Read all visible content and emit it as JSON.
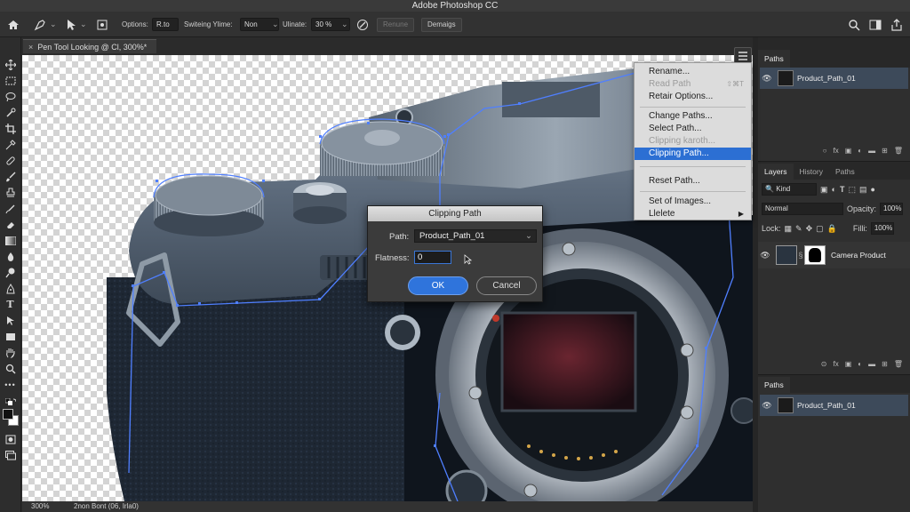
{
  "app": {
    "title": "Adobe Photoshop CC"
  },
  "options_bar": {
    "options_label": "Options:",
    "options_value": "R.to",
    "switching_label": "Switeing Ylime:",
    "switching_value": "Non",
    "ultimate_label": "Ulinate:",
    "ultimate_value": "30 %",
    "rename_button": "Renune",
    "demargs_button": "Demaigs"
  },
  "document": {
    "tab_title": "Pen Tool Looking @ Cl, 300%*",
    "close_symbol": "×"
  },
  "status": {
    "zoom": "300%",
    "info": "2non Bont (06, Irla0)"
  },
  "context_menu": {
    "items": [
      {
        "label": "Rename...",
        "disabled": false,
        "highlighted": false,
        "shortcut": ""
      },
      {
        "label": "Read Path",
        "disabled": true,
        "highlighted": false,
        "shortcut": "⇧⌘T"
      },
      {
        "label": "Retair Options...",
        "disabled": false,
        "highlighted": false,
        "shortcut": ""
      },
      {
        "label": "Change Paths...",
        "disabled": false,
        "highlighted": false,
        "shortcut": ""
      },
      {
        "label": "Select Path...",
        "disabled": false,
        "highlighted": false,
        "shortcut": ""
      },
      {
        "label": "Clipping karoth...",
        "disabled": true,
        "highlighted": false,
        "shortcut": ""
      },
      {
        "label": "Clipping Path...",
        "disabled": false,
        "highlighted": true,
        "shortcut": ""
      },
      {
        "label": "Reset Path...",
        "disabled": false,
        "highlighted": false,
        "shortcut": ""
      },
      {
        "label": "Set of Images...",
        "disabled": false,
        "highlighted": false,
        "shortcut": ""
      },
      {
        "label": "Llelete",
        "disabled": false,
        "highlighted": false,
        "shortcut": "▶"
      }
    ]
  },
  "dialog": {
    "title": "Clipping Path",
    "path_label": "Path:",
    "path_value": "Product_Path_01",
    "flatness_label": "Flatness:",
    "flatness_value": "0",
    "ok_label": "OK",
    "cancel_label": "Cancel"
  },
  "paths_panel_top": {
    "tab": "Paths",
    "path_name": "Product_Path_01"
  },
  "layers_panel": {
    "tabs": [
      "Layers",
      "History",
      "Paths"
    ],
    "kind_label": "Kind",
    "blend_mode": "Normal",
    "opacity_label": "Opacity:",
    "opacity_value": "100%",
    "lock_label": "Lock:",
    "fill_label": "Filli:",
    "fill_value": "100%",
    "layer_name": "Camera Product"
  },
  "paths_panel_bottom": {
    "tab": "Paths",
    "path_name": "Product_Path_01"
  },
  "colors": {
    "accent": "#2c6fd3",
    "path_stroke": "#4f7fff",
    "panel_bg": "#2f2f2f"
  }
}
